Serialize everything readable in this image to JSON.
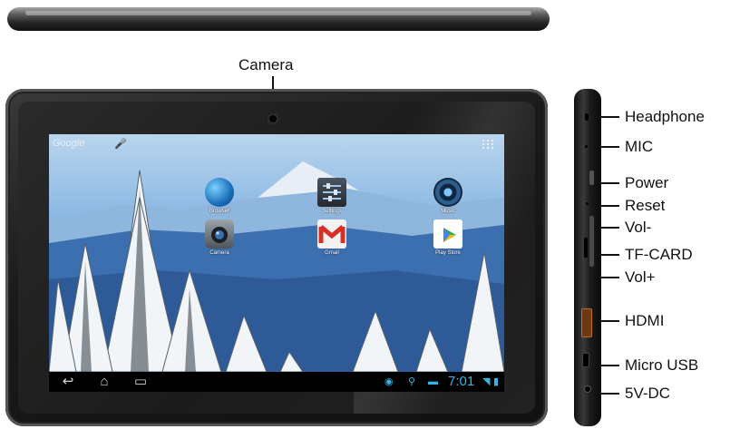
{
  "diagram": {
    "callouts": {
      "camera": "Camera",
      "headphone": "Headphone",
      "mic": "MIC",
      "power": "Power",
      "reset": "Reset",
      "vol_down": "Vol-",
      "tf_card": "TF-CARD",
      "vol_up": "Vol+",
      "hdmi": "HDMI",
      "micro_usb": "Micro USB",
      "dc": "5V-DC"
    },
    "screen": {
      "search_label": "Google",
      "clock": "7:01",
      "apps": [
        {
          "name": "Browser"
        },
        {
          "name": "Settings"
        },
        {
          "name": "Music"
        },
        {
          "name": "Camera"
        },
        {
          "name": "Gmail"
        },
        {
          "name": "Play Store"
        }
      ]
    },
    "colors": {
      "bezel": "#1a1a1a",
      "status_accent": "#33b5e5",
      "label_text": "#111111"
    }
  }
}
